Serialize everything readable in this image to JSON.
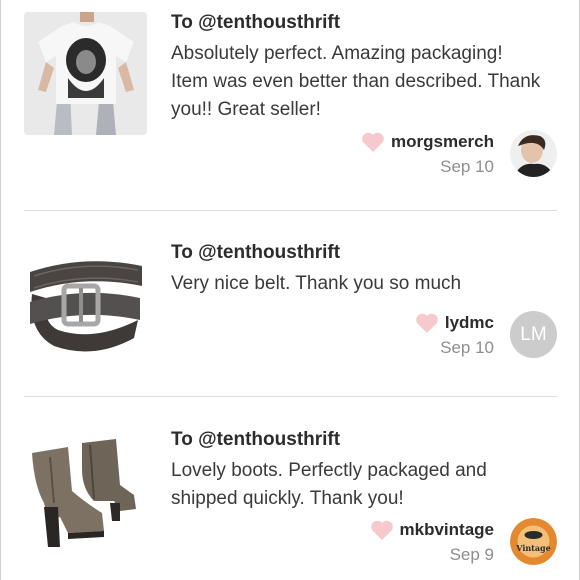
{
  "colors": {
    "heart": "#f7c9cf",
    "divider": "#dddddd",
    "date": "#8e8e8e",
    "text": "#2c2c2c",
    "initials_avatar_bg": "#cccccc"
  },
  "reviews": [
    {
      "to": "To @tenthousthrift",
      "message": "Absolutely perfect. Amazing packaging! Item was even better than described. Thank you!! Great seller!",
      "username": "morgsmerch",
      "date": "Sep 10",
      "item_image": "graphic-tshirt-photo",
      "avatar_type": "photo"
    },
    {
      "to": "To @tenthousthrift",
      "message": "Very nice belt. Thank you so much",
      "username": "lydmc",
      "date": "Sep 10",
      "item_image": "leather-belt-photo",
      "avatar_type": "initials",
      "avatar_initials": "LM"
    },
    {
      "to": "To @tenthousthrift",
      "message": "Lovely boots. Perfectly packaged and shipped quickly. Thank you!",
      "username": "mkbvintage",
      "date": "Sep 9",
      "item_image": "ankle-boots-photo",
      "avatar_type": "photo",
      "avatar_text": "Vintage"
    }
  ]
}
